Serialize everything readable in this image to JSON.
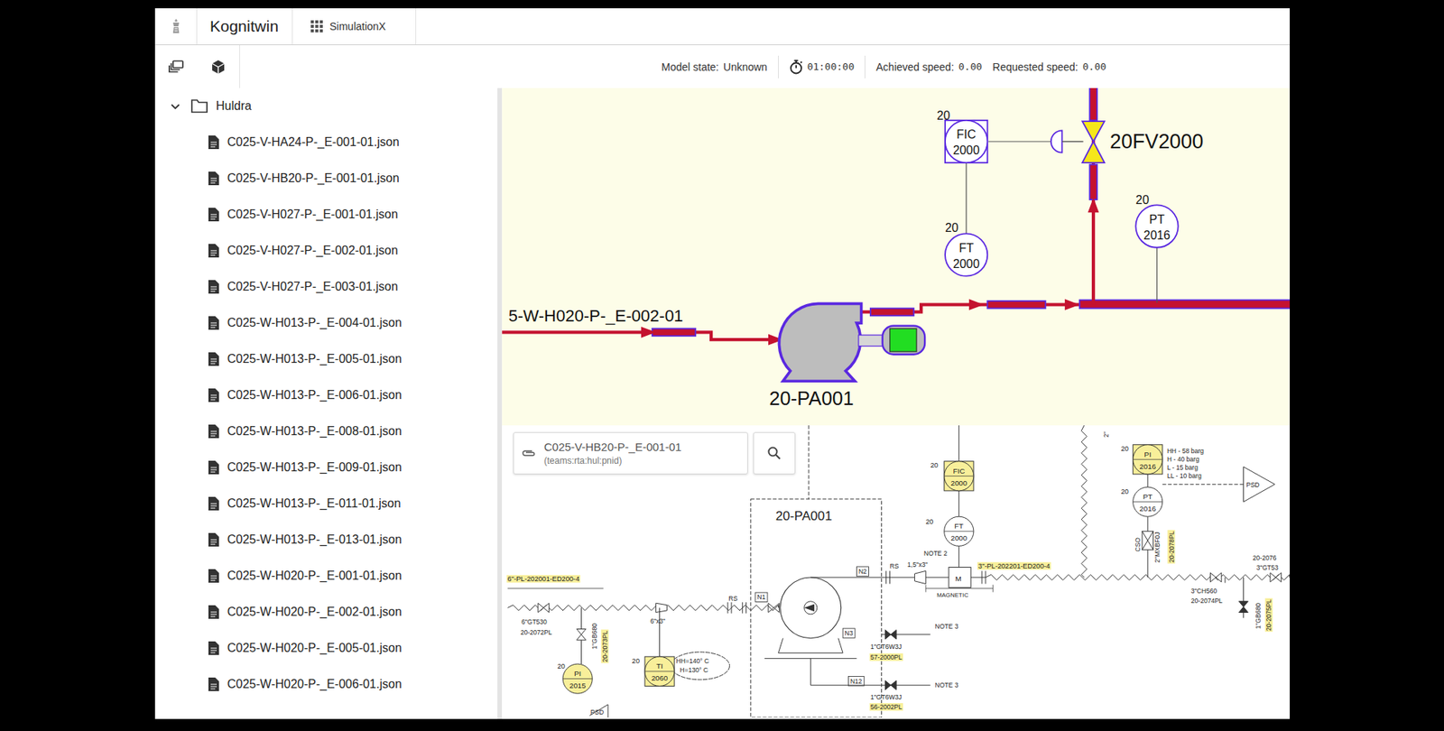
{
  "header": {
    "brand": "Kognitwin",
    "app": "SimulationX"
  },
  "toolbar": {
    "model_state": {
      "label": "Model state:",
      "value": "Unknown"
    },
    "timer": "01:00:00",
    "achieved_speed": {
      "label": "Achieved speed:",
      "value": "0.00"
    },
    "requested_speed": {
      "label": "Requested speed:",
      "value": "0.00"
    }
  },
  "sidebar": {
    "folder": {
      "label": "Huldra",
      "expanded": true
    },
    "items": [
      "C025-V-HA24-P-_E-001-01.json",
      "C025-V-HB20-P-_E-001-01.json",
      "C025-V-H027-P-_E-001-01.json",
      "C025-V-H027-P-_E-002-01.json",
      "C025-V-H027-P-_E-003-01.json",
      "C025-W-H013-P-_E-004-01.json",
      "C025-W-H013-P-_E-005-01.json",
      "C025-W-H013-P-_E-006-01.json",
      "C025-W-H013-P-_E-008-01.json",
      "C025-W-H013-P-_E-009-01.json",
      "C025-W-H013-P-_E-011-01.json",
      "C025-W-H013-P-_E-013-01.json",
      "C025-W-H020-P-_E-001-01.json",
      "C025-W-H020-P-_E-002-01.json",
      "C025-W-H020-P-_E-005-01.json",
      "C025-W-H020-P-_E-006-01.json"
    ]
  },
  "diagram": {
    "line_label": "5-W-H020-P-_E-002-01",
    "valve": {
      "tag": "20FV2000"
    },
    "pump": {
      "tag": "20-PA001",
      "motor_running": true
    },
    "instruments": [
      {
        "loop": "20",
        "type": "FIC",
        "number": "2000"
      },
      {
        "loop": "20",
        "type": "FT",
        "number": "2000"
      },
      {
        "loop": "20",
        "type": "PT",
        "number": "2016"
      }
    ]
  },
  "pnid": {
    "document": "C025-V-HB20-P-_E-001-01",
    "source": "(teams:rta:hul:pnid)",
    "instruments": [
      {
        "loop": "20",
        "type": "FIC",
        "number": "2000",
        "highlighted": true
      },
      {
        "loop": "20",
        "type": "FT",
        "number": "2000",
        "highlighted": false
      },
      {
        "loop": "20",
        "type": "PI",
        "number": "2016",
        "highlighted": true
      },
      {
        "loop": "20",
        "type": "PT",
        "number": "2016",
        "highlighted": false
      },
      {
        "loop": "20",
        "type": "PI",
        "number": "2015",
        "highlighted": true
      },
      {
        "loop": "20",
        "type": "TI",
        "number": "2060",
        "highlighted": true
      }
    ],
    "labels": [
      {
        "text": "6\"-PL-202001-ED200-4",
        "highlighted": true
      },
      {
        "text": "6\"GT530",
        "highlighted": false
      },
      {
        "text": "20-2072PL",
        "highlighted": false
      },
      {
        "text": "1\"GB680",
        "highlighted": false
      },
      {
        "text": "20-2073PL",
        "highlighted": true
      },
      {
        "text": "6\"x3\"",
        "highlighted": false
      },
      {
        "text": "RS",
        "highlighted": false
      },
      {
        "text": "20-PA001",
        "highlighted": false
      },
      {
        "text": "N1",
        "highlighted": false
      },
      {
        "text": "N2",
        "highlighted": false
      },
      {
        "text": "N3",
        "highlighted": false
      },
      {
        "text": "N12",
        "highlighted": false
      },
      {
        "text": "1\"GT6W3J",
        "highlighted": false
      },
      {
        "text": "57-2000PL",
        "highlighted": true
      },
      {
        "text": "1\"GT6W3J",
        "highlighted": false
      },
      {
        "text": "56-2002PL",
        "highlighted": true
      },
      {
        "text": "NOTE 3",
        "highlighted": false
      },
      {
        "text": "NOTE 3",
        "highlighted": false
      },
      {
        "text": "NOTE 2",
        "highlighted": false
      },
      {
        "text": "RS",
        "highlighted": false
      },
      {
        "text": "1,5\"x3\"",
        "highlighted": false
      },
      {
        "text": "M",
        "highlighted": false
      },
      {
        "text": "MAGNETIC",
        "highlighted": false
      },
      {
        "text": "3\"-PL-202201-ED200-4",
        "highlighted": true
      },
      {
        "text": "3\"CH560",
        "highlighted": false
      },
      {
        "text": "20-2074PL",
        "highlighted": false
      },
      {
        "text": "20-2076",
        "highlighted": false
      },
      {
        "text": "3\"GT53",
        "highlighted": false
      },
      {
        "text": "CSO",
        "highlighted": false
      },
      {
        "text": "2\"MXBF0J",
        "highlighted": false
      },
      {
        "text": "20-2078PL",
        "highlighted": true
      },
      {
        "text": "1\"GB680",
        "highlighted": false
      },
      {
        "text": "20-2075PL",
        "highlighted": true
      },
      {
        "text": "2\"",
        "highlighted": false
      },
      {
        "text": "HH - 58 barg",
        "highlighted": false
      },
      {
        "text": "H - 40 barg",
        "highlighted": false
      },
      {
        "text": "L - 15 barg",
        "highlighted": false
      },
      {
        "text": "LL - 10 barg",
        "highlighted": false
      },
      {
        "text": "PSD",
        "highlighted": false
      },
      {
        "text": "PSD",
        "highlighted": false
      },
      {
        "text": "HH=140° C",
        "highlighted": false
      },
      {
        "text": "H=130° C",
        "highlighted": false
      }
    ]
  }
}
